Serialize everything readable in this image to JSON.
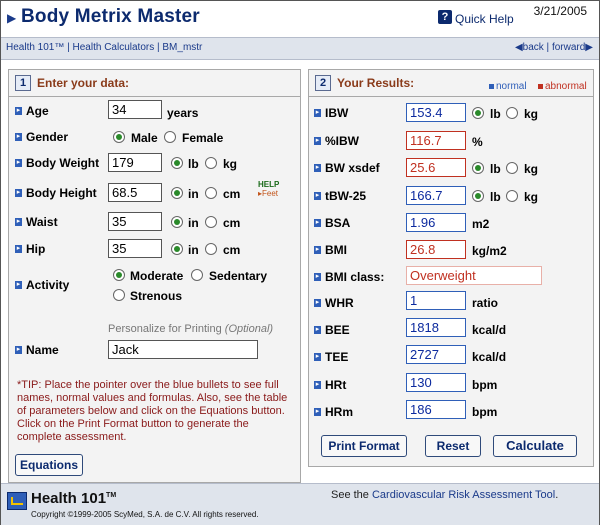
{
  "header": {
    "title": "Body Metrix Master",
    "quick_help": "Quick Help",
    "date": "3/21/2005"
  },
  "nav": {
    "breadcrumb": "Health 101™ | Health Calculators | BM_mstr",
    "back": "back",
    "forward": "forward",
    "separator": "|"
  },
  "left": {
    "number": "1",
    "heading": "Enter your data:",
    "age": {
      "label": "Age",
      "value": "34",
      "unit": "years"
    },
    "gender": {
      "label": "Gender",
      "male": "Male",
      "female": "Female",
      "selected": "Male"
    },
    "weight": {
      "label": "Body Weight",
      "value": "179",
      "unit_a": "lb",
      "unit_b": "kg",
      "selected": "lb"
    },
    "height": {
      "label": "Body Height",
      "value": "68.5",
      "unit_a": "in",
      "unit_b": "cm",
      "selected": "in",
      "help": "HELP",
      "help_feet": "Feet"
    },
    "waist": {
      "label": "Waist",
      "value": "35",
      "unit_a": "in",
      "unit_b": "cm",
      "selected": "in"
    },
    "hip": {
      "label": "Hip",
      "value": "35",
      "unit_a": "in",
      "unit_b": "cm",
      "selected": "in"
    },
    "activity": {
      "label": "Activity",
      "moderate": "Moderate",
      "sedentary": "Sedentary",
      "strenous": "Strenous",
      "selected": "Moderate"
    },
    "personalize": {
      "text": "Personalize for Printing ",
      "optional": "(Optional)"
    },
    "name": {
      "label": "Name",
      "value": "Jack"
    },
    "tip": "*TIP: Place the pointer over the blue bullets to see full names, normal values and formulas. Also, see the table of parameters below and click on the Equations button. Click on the Print Format button to generate the complete assessment.",
    "equations_button": "Equations"
  },
  "right": {
    "number": "2",
    "heading": "Your Results:",
    "legend_normal": "normal",
    "legend_abnormal": "abnormal",
    "rows": [
      {
        "label": "IBW",
        "value": "153.4",
        "status": "normal",
        "unit_a": "lb",
        "unit_b": "kg",
        "selected": "lb"
      },
      {
        "label": "%IBW",
        "value": "116.7",
        "status": "abnormal",
        "unit": "%"
      },
      {
        "label": "BW xsdef",
        "value": "25.6",
        "status": "abnormal",
        "unit_a": "lb",
        "unit_b": "kg",
        "selected": "lb"
      },
      {
        "label": "tBW-25",
        "value": "166.7",
        "status": "normal",
        "unit_a": "lb",
        "unit_b": "kg",
        "selected": "lb"
      },
      {
        "label": "BSA",
        "value": "1.96",
        "status": "normal",
        "unit": "m2"
      },
      {
        "label": "BMI",
        "value": "26.8",
        "status": "abnormal",
        "unit": "kg/m2"
      },
      {
        "label": "BMI class:",
        "value": "Overweight",
        "status": "abnormal"
      },
      {
        "label": "WHR",
        "value": "1",
        "status": "normal",
        "unit": "ratio"
      },
      {
        "label": "BEE",
        "value": "1818",
        "status": "normal",
        "unit": "kcal/d"
      },
      {
        "label": "TEE",
        "value": "2727",
        "status": "normal",
        "unit": "kcal/d"
      },
      {
        "label": "HRt",
        "value": "130",
        "status": "normal",
        "unit": "bpm"
      },
      {
        "label": "HRm",
        "value": "186",
        "status": "normal",
        "unit": "bpm"
      }
    ],
    "print_button": "Print Format",
    "reset_button": "Reset",
    "calculate_button": "Calculate"
  },
  "footer": {
    "logo": "Health 101",
    "logo_tm": "TM",
    "copyright": "Copyright ©1999-2005 ScyMed, S.A. de C.V.  All rights reserved.",
    "see_prefix": "See the ",
    "see_link": "Cardiovascular Risk Assessment Tool",
    "see_suffix": "."
  },
  "colors": {
    "title_blue": "#0c2a6e",
    "bullet_blue": "#2f5fb8",
    "abnormal_red": "#c03020",
    "radio_green": "#2a8a2a"
  }
}
